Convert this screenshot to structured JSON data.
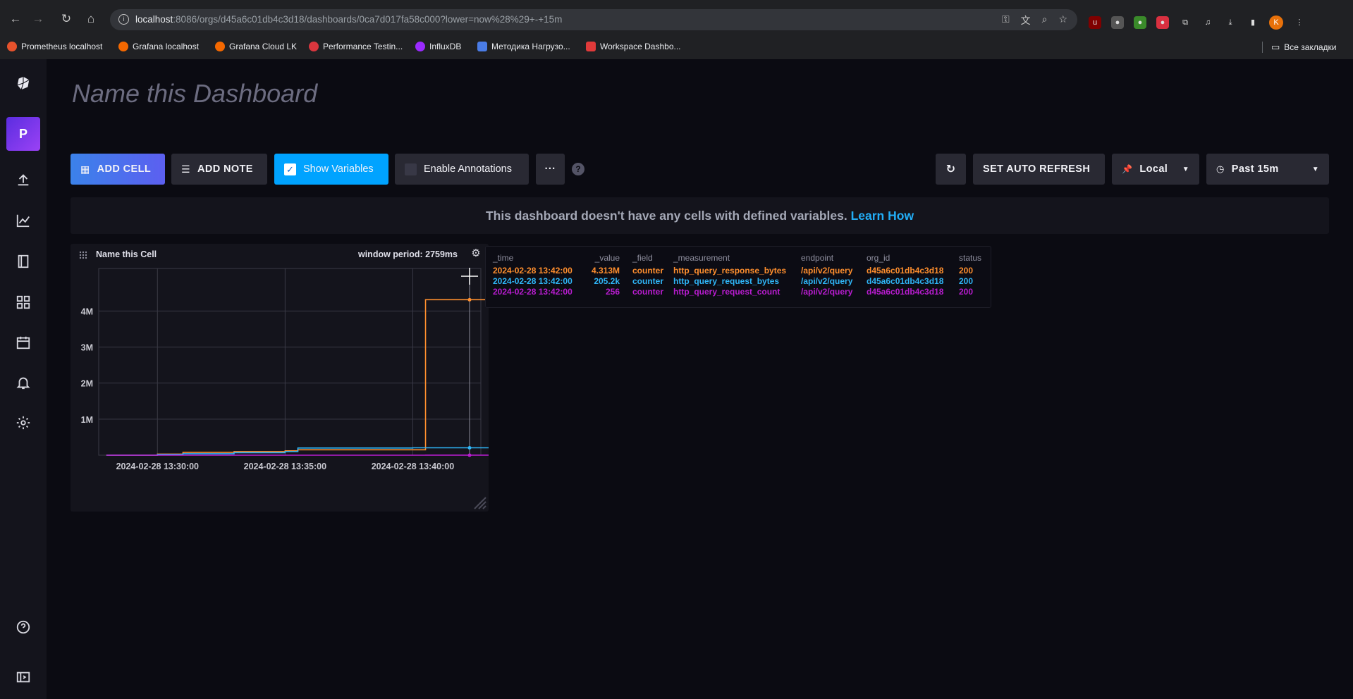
{
  "browser": {
    "url_host": "localhost",
    "url_rest": ":8086/orgs/d45a6c01db4c3d18/dashboards/0ca7d017fa58c000?lower=now%28%29+-+15m",
    "profile_initial": "K",
    "bookmarks": [
      {
        "label": "Prometheus localhost",
        "color": "#e6522c"
      },
      {
        "label": "Grafana localhost",
        "color": "#f46800"
      },
      {
        "label": "Grafana Cloud LK",
        "color": "#f46800"
      },
      {
        "label": "Performance Testin...",
        "color": "#d9363e"
      },
      {
        "label": "InfluxDB",
        "color": "#9b2aff"
      },
      {
        "label": "Методика Нагрузо...",
        "color": "#4a7ce6"
      },
      {
        "label": "Workspace Dashbo...",
        "color": "#e03a3a"
      }
    ],
    "all_bookmarks": "Все закладки"
  },
  "sidebar": {
    "org_initial": "P"
  },
  "dashboard": {
    "title_placeholder": "Name this Dashboard"
  },
  "controls": {
    "add_cell": "ADD CELL",
    "add_note": "ADD NOTE",
    "show_variables": "Show Variables",
    "enable_annotations": "Enable Annotations",
    "more": "···",
    "help": "?",
    "set_auto_refresh": "SET AUTO REFRESH",
    "timezone": "Local",
    "time_range": "Past 15m"
  },
  "banner": {
    "text": "This dashboard doesn't have any cells with defined variables.",
    "link": "Learn How"
  },
  "cell": {
    "title": "Name this Cell",
    "window_period": "window period: 2759ms"
  },
  "chart_data": {
    "type": "line",
    "title": "",
    "xlabel": "",
    "ylabel": "",
    "x_ticks": [
      "2024-02-28 13:30:00",
      "2024-02-28 13:35:00",
      "2024-02-28 13:40:00"
    ],
    "y_ticks": [
      "1M",
      "2M",
      "3M",
      "4M"
    ],
    "ylim": [
      0,
      4300000
    ],
    "x": [
      "13:28:00",
      "13:30:00",
      "13:31:00",
      "13:33:00",
      "13:35:00",
      "13:35:30",
      "13:40:00",
      "13:40:30",
      "13:42:00",
      "13:43:00"
    ],
    "series": [
      {
        "name": "http_query_response_bytes",
        "color": "#ff8f2e",
        "values": [
          0,
          30000,
          80000,
          100000,
          120000,
          150000,
          150000,
          4313000,
          4313000,
          4313000
        ]
      },
      {
        "name": "http_query_request_bytes",
        "color": "#2fb6f8",
        "values": [
          0,
          20000,
          40000,
          70000,
          100000,
          200000,
          205000,
          205200,
          205200,
          205200
        ]
      },
      {
        "name": "http_query_request_count",
        "color": "#b81ccf",
        "values": [
          0,
          20,
          50,
          80,
          120,
          180,
          230,
          250,
          256,
          256
        ]
      }
    ]
  },
  "tooltip": {
    "headers": [
      "_time",
      "_value",
      "_field",
      "_measurement",
      "endpoint",
      "org_id",
      "status"
    ],
    "rows": [
      {
        "time": "2024-02-28 13:42:00",
        "value": "4.313M",
        "field": "counter",
        "measurement": "http_query_response_bytes",
        "endpoint": "/api/v2/query",
        "org_id": "d45a6c01db4c3d18",
        "status": "200"
      },
      {
        "time": "2024-02-28 13:42:00",
        "value": "205.2k",
        "field": "counter",
        "measurement": "http_query_request_bytes",
        "endpoint": "/api/v2/query",
        "org_id": "d45a6c01db4c3d18",
        "status": "200"
      },
      {
        "time": "2024-02-28 13:42:00",
        "value": "256",
        "field": "counter",
        "measurement": "http_query_request_count",
        "endpoint": "/api/v2/query",
        "org_id": "d45a6c01db4c3d18",
        "status": "200"
      }
    ]
  }
}
